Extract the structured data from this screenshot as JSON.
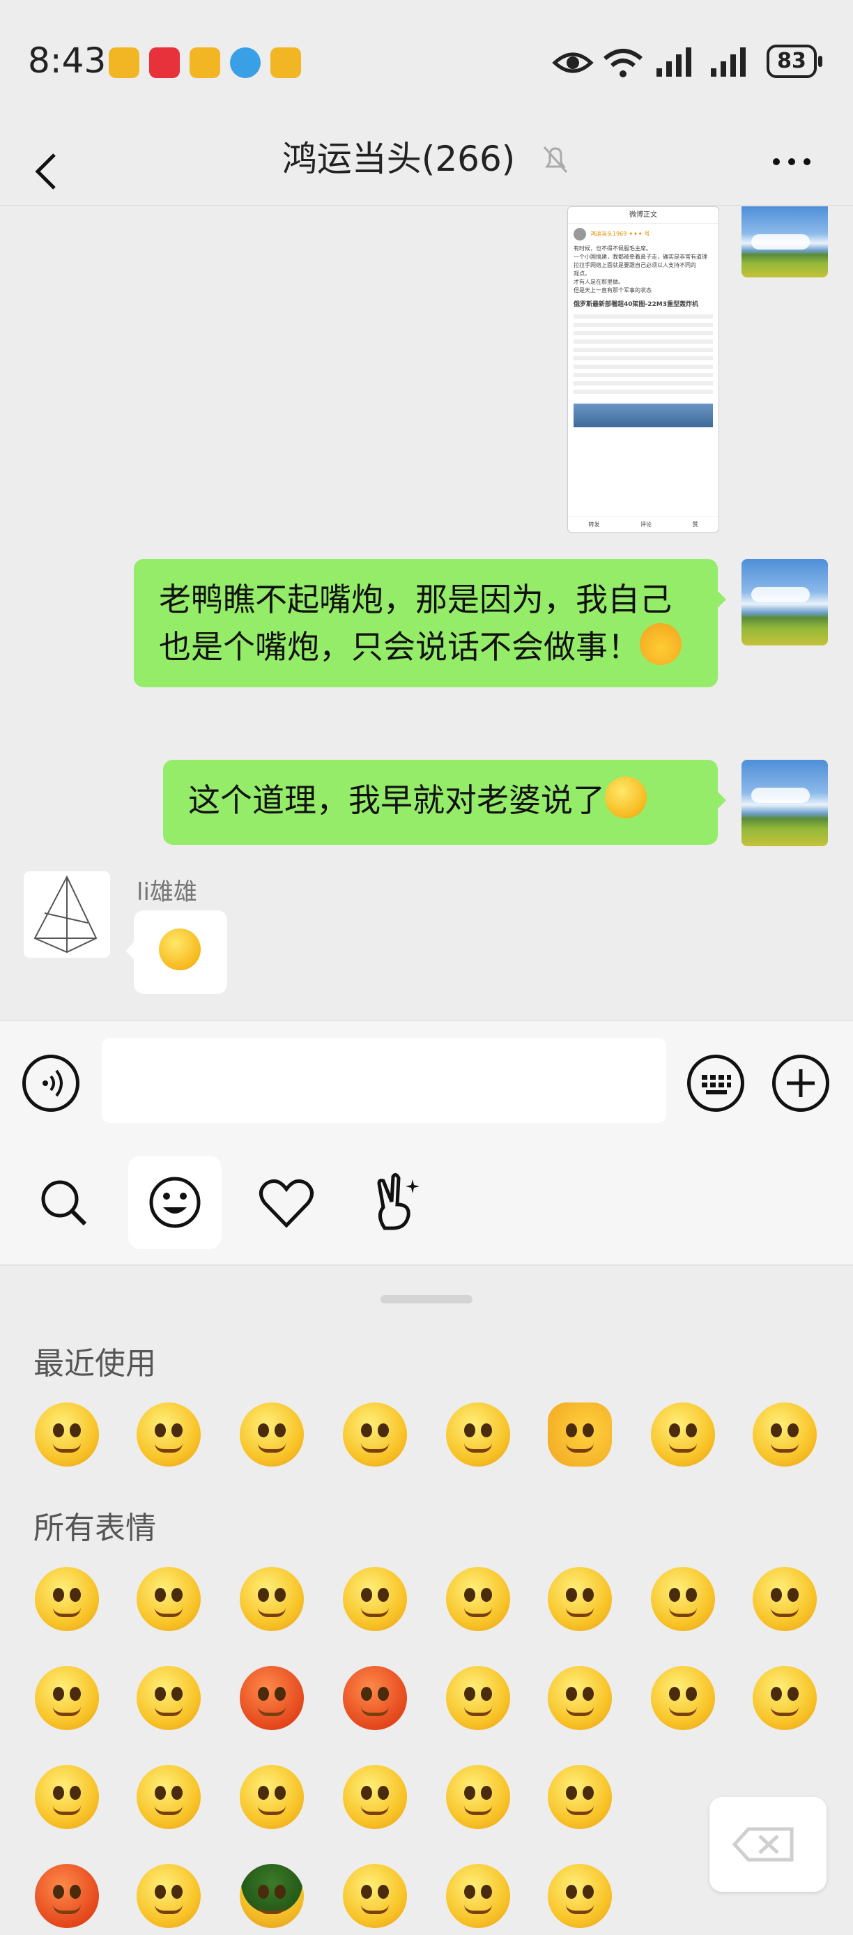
{
  "status_bar": {
    "time": "8:43",
    "battery": "83"
  },
  "header": {
    "title": "鸿运当头(266)"
  },
  "messages": [
    {
      "side": "right",
      "type": "image"
    },
    {
      "side": "right",
      "type": "text",
      "text": "老鸭瞧不起嘴炮，那是因为，我自己也是个嘴炮，只会说话不会做事！",
      "emoji": "praying-hands"
    },
    {
      "side": "right",
      "type": "text",
      "text": "这个道理，我早就对老婆说了",
      "emoji": "pleading-face"
    },
    {
      "side": "left",
      "sender": "li雄雄",
      "type": "emoji",
      "emoji": "smirk-face"
    }
  ],
  "screenshot_card": {
    "header": "微博正文",
    "username": "鸿运当头1969 ✦✦✦ 号",
    "lines": [
      "有时候，也不得不佩服毛主席。",
      "一个小国搞建，我都被牵着鼻子走，确实是非常有道理",
      "拉拉手网络上面就是要跟自己必须以人支持不同的",
      "观点。",
      "才有人是在那里做。",
      "但是天上一直有那个军事的状态"
    ],
    "embedded_title": "俄罗斯最新部署超40架图-22M3重型轰炸机",
    "footer": [
      "转发",
      "评论",
      "赞"
    ]
  },
  "input": {
    "placeholder": ""
  },
  "emoji_tabs": [
    "search",
    "emoji",
    "favorites",
    "stickers"
  ],
  "emoji_panel": {
    "recent_label": "最近使用",
    "all_label": "所有表情",
    "recent": [
      "praying-hands",
      "grin",
      "worried",
      "pleading",
      "smirk",
      "thumbs-up",
      "sick",
      "crying"
    ],
    "all_rows": [
      [
        "smile",
        "worried",
        "heart-eyes",
        "surprised",
        "sunglasses",
        "crying",
        "blush",
        "zipped"
      ],
      [
        "sleepy",
        "tears",
        "red-sweat",
        "angry",
        "tongue-wink",
        "grin",
        "bandaged",
        "sad"
      ],
      [
        "pleading",
        "laugh-cry",
        "sick-sweat",
        "smirk",
        "smile-blush",
        "shocked"
      ],
      [
        "angry-sweat",
        "grin",
        "helmet",
        "tongue",
        "question",
        "hmm"
      ]
    ]
  },
  "colors": {
    "bubble_green": "#95ec69",
    "background": "#ededed",
    "panel": "#f6f6f6"
  }
}
